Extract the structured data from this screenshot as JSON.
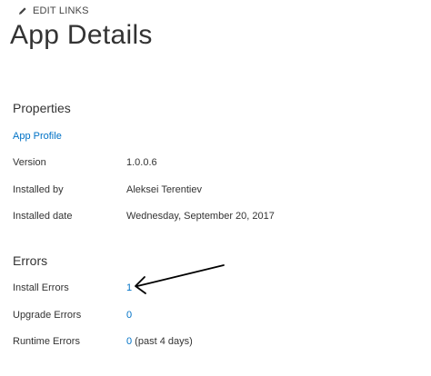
{
  "header": {
    "edit_links_label": "EDIT LINKS",
    "edit_icon": "pencil-icon",
    "title": "App Details"
  },
  "properties": {
    "heading": "Properties",
    "app_profile_link": "App Profile",
    "rows": [
      {
        "label": "Version",
        "value": "1.0.0.6"
      },
      {
        "label": "Installed by",
        "value": "Aleksei Terentiev"
      },
      {
        "label": "Installed date",
        "value": "Wednesday, September 20, 2017"
      }
    ]
  },
  "errors": {
    "heading": "Errors",
    "install": {
      "label": "Install Errors",
      "count": "1"
    },
    "upgrade": {
      "label": "Upgrade Errors",
      "count": "0"
    },
    "runtime": {
      "label": "Runtime Errors",
      "count": "0",
      "suffix": " (past 4 days)"
    }
  },
  "annotation": {
    "icon": "hand-drawn-arrow-icon",
    "color": "#000000"
  },
  "colors": {
    "link": "#0072c6",
    "text": "#333333"
  }
}
